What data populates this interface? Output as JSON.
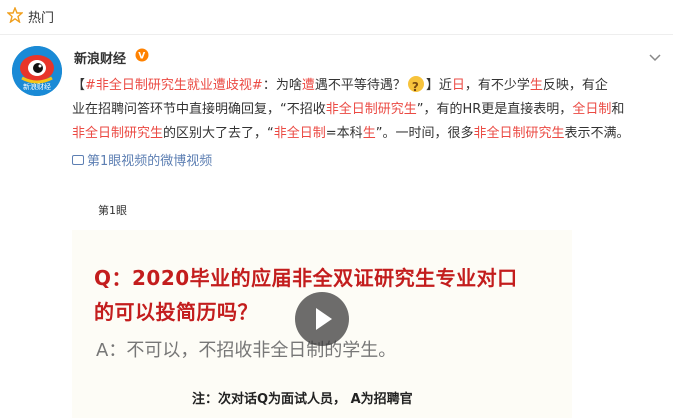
{
  "topbar": {
    "label": "热门"
  },
  "account": {
    "name": "新浪财经",
    "avatar_text": "新浪财经"
  },
  "post": {
    "line1": [
      {
        "t": "【",
        "c": "plain"
      },
      {
        "t": "#非全日制研究生就业遭歧视#",
        "c": "red"
      },
      {
        "t": "：为啥",
        "c": "plain"
      },
      {
        "t": "遭",
        "c": "red"
      },
      {
        "t": "遇不平等待遇？",
        "c": "plain"
      },
      {
        "t": "】近",
        "c": "plain"
      },
      {
        "t": "日",
        "c": "red"
      },
      {
        "t": "，有不少学",
        "c": "plain"
      },
      {
        "t": "生",
        "c": "red"
      },
      {
        "t": "反映，有企",
        "c": "plain"
      }
    ],
    "line2": [
      {
        "t": "业在招聘问答环节中直接明确回复，“不招收",
        "c": "plain"
      },
      {
        "t": "非全日制研究生",
        "c": "red"
      },
      {
        "t": "”，有的HR更是直接表明，",
        "c": "plain"
      },
      {
        "t": "全日制",
        "c": "red"
      },
      {
        "t": "和",
        "c": "plain"
      }
    ],
    "line3": [
      {
        "t": "非全日制研究生",
        "c": "red"
      },
      {
        "t": "的区别大了去了，“",
        "c": "plain"
      },
      {
        "t": "非全日制",
        "c": "red"
      },
      {
        "t": "=本科",
        "c": "plain"
      },
      {
        "t": "生",
        "c": "red"
      },
      {
        "t": "”。一时间，很多",
        "c": "plain"
      },
      {
        "t": "非全日制研究生",
        "c": "red"
      },
      {
        "t": "表示不满。",
        "c": "plain"
      }
    ]
  },
  "video_link": "第1眼视频的微博视频",
  "video": {
    "tag": "第1眼",
    "q_line1": "Q：2020毕业的应届非全双证研究生专业对口",
    "q_line2": "的可以投简历吗？",
    "a_line": "A：不可以，不招收非全日制的学生。",
    "note": "注：次对话Q为面试人员， A为招聘官"
  },
  "colors": {
    "accent_red": "#eb4a43",
    "link_blue": "#5d7fb3",
    "q_red": "#c31d1d"
  }
}
